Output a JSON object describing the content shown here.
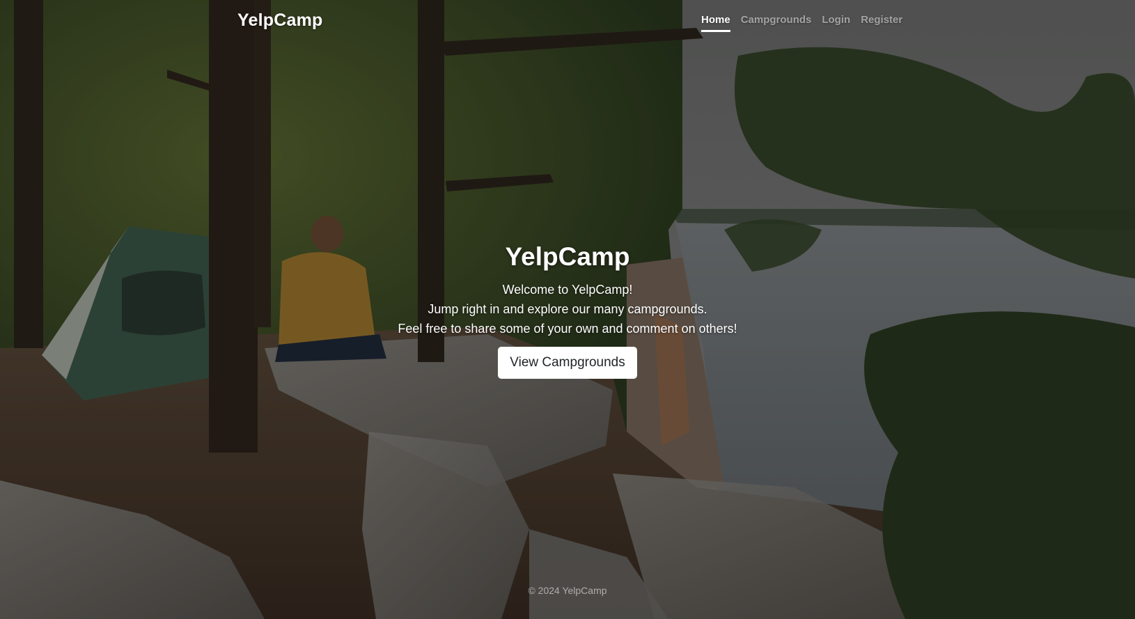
{
  "navbar": {
    "brand": "YelpCamp",
    "links": [
      {
        "label": "Home",
        "active": true
      },
      {
        "label": "Campgrounds",
        "active": false
      },
      {
        "label": "Login",
        "active": false
      },
      {
        "label": "Register",
        "active": false
      }
    ]
  },
  "hero": {
    "title": "YelpCamp",
    "lines": [
      "Welcome to YelpCamp!",
      "Jump right in and explore our many campgrounds.",
      "Feel free to share some of your own and comment on others!"
    ],
    "cta_label": "View Campgrounds"
  },
  "footer": {
    "text": "© 2024 YelpCamp"
  },
  "colors": {
    "overlay": "#000000",
    "button_bg": "#ffffff",
    "button_text": "#212529",
    "nav_active": "#ffffff",
    "nav_inactive": "#8a8a8a"
  }
}
